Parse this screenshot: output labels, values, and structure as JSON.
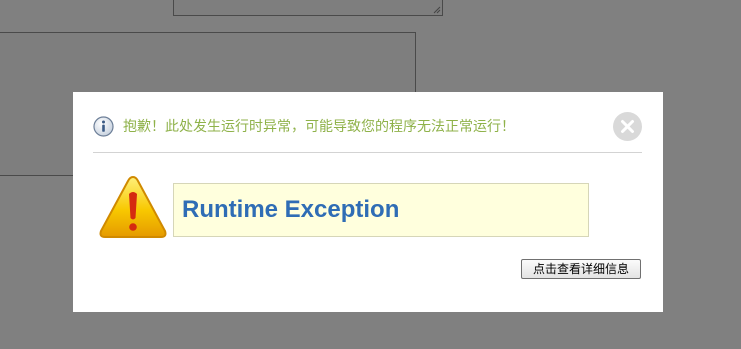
{
  "dialog": {
    "message": "抱歉！此处发生运行时异常，可能导致您的程序无法正常运行！",
    "exception_title": "Runtime Exception",
    "details_button_label": "点击查看详细信息"
  },
  "icons": {
    "info": "info-icon",
    "close": "close-icon",
    "warning": "warning-icon",
    "resize": "resize-grip-icon"
  },
  "colors": {
    "overlay": "#808080",
    "message_text": "#8fb24a",
    "exception_text": "#2f6db5",
    "exception_background": "#ffffdd",
    "warning_fill": "#f5b800"
  }
}
